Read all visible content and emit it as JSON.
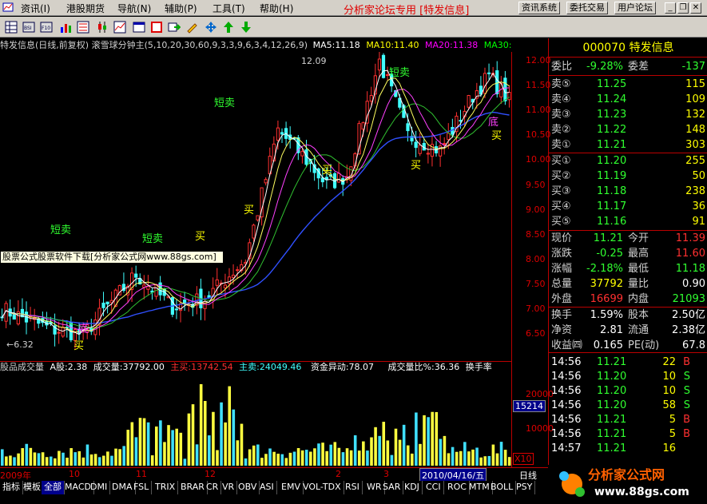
{
  "menu": {
    "items": [
      "资讯(I)",
      "港股期货",
      "导航(N)",
      "辅助(P)",
      "工具(T)",
      "帮助(H)"
    ],
    "banner": "分析家论坛专用 [特发信息]",
    "buttons": [
      "资讯系统",
      "委托交易",
      "用户论坛"
    ]
  },
  "header": {
    "title": "特发信息(日线,前复权) 滚雪球分钟主(5,10,20,30,60,9,3,3,9,6,3,4,12,26,9)",
    "ma5": "MA5:11.18",
    "ma10": "MA10:11.40",
    "ma20": "MA20:11.38",
    "ma30": "MA30:"
  },
  "chart": {
    "annotations": {
      "high": "12.09",
      "low": "←6.32",
      "short1": "短卖",
      "short2": "短卖",
      "short3": "短卖",
      "short4": "短卖",
      "buy1": "买",
      "buy2": "买",
      "buy3": "买",
      "buy4": "买",
      "buy5": "买",
      "bottom1": "底",
      "bottom2": "底"
    },
    "price_axis": [
      "12.00",
      "11.50",
      "11.00",
      "10.50",
      "10.00",
      "9.50",
      "9.00",
      "8.50",
      "8.00",
      "7.50",
      "7.00",
      "6.50"
    ],
    "watermark": "股票公式股票软件下载[分析家公式网www.88gs.com]"
  },
  "volume": {
    "header": {
      "name": "股品成交量",
      "a": "A股:2.38",
      "vol": "成交量:37792.00",
      "buy": "主买:13742.54",
      "sell": "主卖:24049.46",
      "fund": "资金异动:78.07",
      "ratio": "成交量比%:36.36",
      "turn": "换手率"
    },
    "axis": [
      "20000",
      "15214",
      "10000",
      "X10"
    ]
  },
  "date_axis": {
    "labels": [
      "2009年",
      "10",
      "11",
      "12",
      "2",
      "3"
    ],
    "highlight": "2010/04/16/五",
    "mode": "日线"
  },
  "tabs": [
    "指标",
    "模板",
    "全部",
    "MACD",
    "DMI",
    "DMA",
    "FSL",
    "TRIX",
    "BRAR",
    "CR",
    "VR",
    "OBV",
    "ASI",
    "EMV",
    "VOL-TDX",
    "RSI",
    "WR",
    "SAR",
    "KDJ",
    "CCI",
    "ROC",
    "MTM",
    "BOLL",
    "PSY"
  ],
  "quote": {
    "code_name": "000070 特发信息",
    "weibi_label": "委比",
    "weibi": "-9.28%",
    "weicha_label": "委差",
    "weicha": "-137",
    "asks": [
      {
        "label": "卖⑤",
        "price": "11.25",
        "vol": "115"
      },
      {
        "label": "卖④",
        "price": "11.24",
        "vol": "109"
      },
      {
        "label": "卖③",
        "price": "11.23",
        "vol": "132"
      },
      {
        "label": "卖②",
        "price": "11.22",
        "vol": "148"
      },
      {
        "label": "卖①",
        "price": "11.21",
        "vol": "303"
      }
    ],
    "bids": [
      {
        "label": "买①",
        "price": "11.20",
        "vol": "255"
      },
      {
        "label": "买②",
        "price": "11.19",
        "vol": "50"
      },
      {
        "label": "买③",
        "price": "11.18",
        "vol": "238"
      },
      {
        "label": "买④",
        "price": "11.17",
        "vol": "36"
      },
      {
        "label": "买⑤",
        "price": "11.16",
        "vol": "91"
      }
    ],
    "stats": [
      {
        "l1": "现价",
        "v1": "11.21",
        "l2": "今开",
        "v2": "11.39"
      },
      {
        "l1": "涨跌",
        "v1": "-0.25",
        "l2": "最高",
        "v2": "11.60"
      },
      {
        "l1": "涨幅",
        "v1": "-2.18%",
        "l2": "最低",
        "v2": "11.18"
      },
      {
        "l1": "总量",
        "v1": "37792",
        "l2": "量比",
        "v2": "0.90"
      },
      {
        "l1": "外盘",
        "v1": "16699",
        "l2": "内盘",
        "v2": "21093"
      }
    ],
    "stats2": [
      {
        "l1": "换手",
        "v1": "1.59%",
        "l2": "股本",
        "v2": "2.50亿"
      },
      {
        "l1": "净资",
        "v1": "2.81",
        "l2": "流通",
        "v2": "2.38亿"
      },
      {
        "l1": "收益㈣",
        "v1": "0.165",
        "l2": "PE(动)",
        "v2": "67.8"
      }
    ],
    "ticks": [
      {
        "t": "14:56",
        "p": "11.21",
        "v": "22",
        "s": "B"
      },
      {
        "t": "14:56",
        "p": "11.20",
        "v": "10",
        "s": "S"
      },
      {
        "t": "14:56",
        "p": "11.20",
        "v": "10",
        "s": "S"
      },
      {
        "t": "14:56",
        "p": "11.20",
        "v": "58",
        "s": "S"
      },
      {
        "t": "14:56",
        "p": "11.21",
        "v": "5",
        "s": "B"
      },
      {
        "t": "14:56",
        "p": "11.21",
        "v": "5",
        "s": "B"
      },
      {
        "t": "14:57",
        "p": "11.21",
        "v": "16",
        "s": ""
      }
    ]
  },
  "logo": {
    "text": "分析家公式网",
    "url": "www.88gs.com"
  }
}
